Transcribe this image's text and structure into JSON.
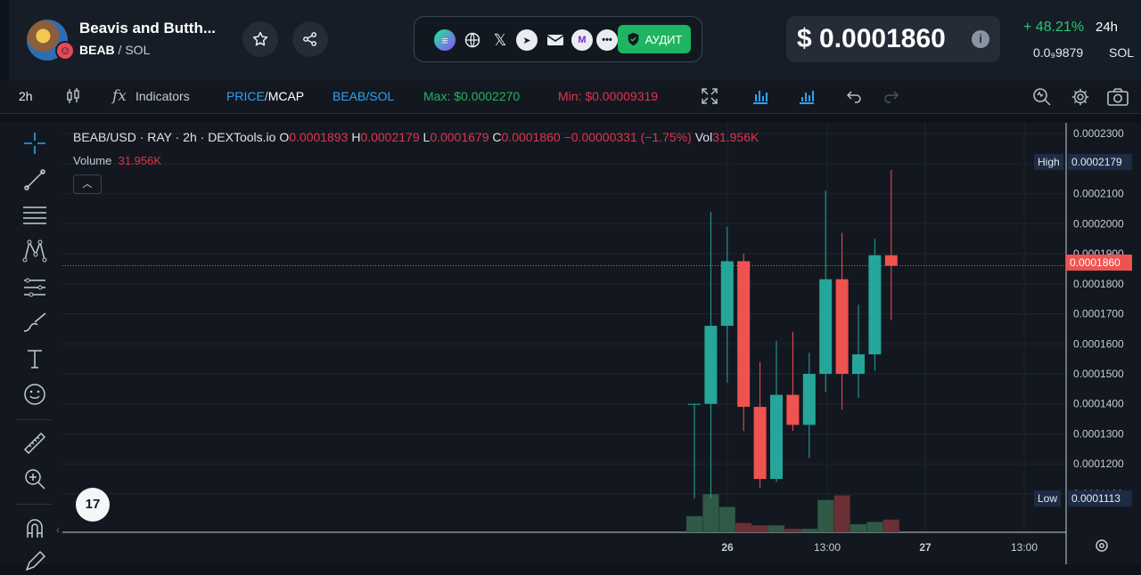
{
  "header": {
    "token_name": "Beavis and Butth...",
    "token_symbol": "BEAB",
    "chain": "SOL",
    "audit_label": "АУДИТ",
    "price": "$ 0.0001860",
    "change": "+ 48.21%",
    "period": "24h",
    "sol_price": "0.0₉9879",
    "sol_unit": "SOL",
    "icons": [
      "star-icon",
      "share-icon",
      "solana-icon",
      "globe-icon",
      "x-icon",
      "telegram-icon",
      "email-icon",
      "scan-icon",
      "more-icon",
      "shield-icon",
      "info-icon"
    ]
  },
  "toolbar": {
    "interval": "2h",
    "indicators": "Indicators",
    "price": "PRICE",
    "mcap": "MCAP",
    "pair": "BEAB/SOL",
    "max": "Max: $0.0002270",
    "min": "Min: $0.00009319"
  },
  "legend": {
    "title": "BEAB/USD · RAY · 2h · DEXTools.io",
    "o_label": "O",
    "o": "0.0001893",
    "h_label": "H",
    "h": "0.0002179",
    "l_label": "L",
    "l": "0.0001679",
    "c_label": "C",
    "c": "0.0001860",
    "change": "−0.00000331 (−1.75%)",
    "vol_label": "Vol",
    "vol": "31.956K",
    "volume_label": "Volume",
    "volume_value": "31.956K"
  },
  "tags": {
    "high_label": "High",
    "high_value": "0.0002179",
    "current_value": "0.0001860",
    "low_label": "Low",
    "low_value": "0.0001113"
  },
  "colors": {
    "up": "#26a69a",
    "down": "#ef5350",
    "up_vol": "#2f5a47",
    "down_vol": "#6b3036"
  },
  "chart_data": {
    "type": "candlestick",
    "y_ticks": [
      "0.0002300",
      "0.0002200",
      "0.0002100",
      "0.0002000",
      "0.0001900",
      "0.0001800",
      "0.0001700",
      "0.0001600",
      "0.0001500",
      "0.0001400",
      "0.0001300",
      "0.0001200",
      "0.0001100"
    ],
    "x_ticks": [
      "26",
      "13:00",
      "27",
      "13:00"
    ],
    "ylim": [
      0.0001085,
      0.000233
    ],
    "candles": [
      {
        "o": 0.00014,
        "h": 0.00014,
        "l": 0.0001085,
        "c": 0.00014,
        "v": 0.14
      },
      {
        "o": 0.00014,
        "h": 0.000204,
        "l": 0.0001085,
        "c": 0.000166,
        "v": 0.33
      },
      {
        "o": 0.000166,
        "h": 0.000199,
        "l": 0.000147,
        "c": 0.0001875,
        "v": 0.22
      },
      {
        "o": 0.0001875,
        "h": 0.00019,
        "l": 0.000131,
        "c": 0.000139,
        "v": 0.08
      },
      {
        "o": 0.000139,
        "h": 0.000154,
        "l": 0.000112,
        "c": 0.000115,
        "v": 0.06
      },
      {
        "o": 0.000115,
        "h": 0.000161,
        "l": 0.000114,
        "c": 0.000143,
        "v": 0.06
      },
      {
        "o": 0.000143,
        "h": 0.000164,
        "l": 0.000131,
        "c": 0.000133,
        "v": 0.03
      },
      {
        "o": 0.000133,
        "h": 0.000157,
        "l": 0.000122,
        "c": 0.00015,
        "v": 0.03
      },
      {
        "o": 0.00015,
        "h": 0.000211,
        "l": 0.000144,
        "c": 0.0001815,
        "v": 0.28
      },
      {
        "o": 0.0001815,
        "h": 0.000197,
        "l": 0.000138,
        "c": 0.00015,
        "v": 0.32
      },
      {
        "o": 0.00015,
        "h": 0.000173,
        "l": 0.000142,
        "c": 0.0001565,
        "v": 0.07
      },
      {
        "o": 0.0001565,
        "h": 0.000195,
        "l": 0.000151,
        "c": 0.0001895,
        "v": 0.09
      },
      {
        "o": 0.0001895,
        "h": 0.0002179,
        "l": 0.0001679,
        "c": 0.000186,
        "v": 0.11
      }
    ]
  }
}
